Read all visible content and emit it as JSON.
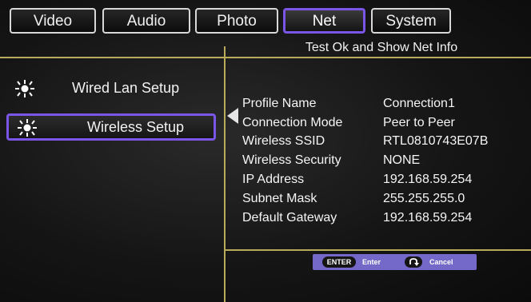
{
  "tabs": [
    {
      "label": "Video"
    },
    {
      "label": "Audio"
    },
    {
      "label": "Photo"
    },
    {
      "label": "Net"
    },
    {
      "label": "System"
    }
  ],
  "active_tab": "Net",
  "subtitle": "Test Ok and Show Net Info",
  "menu": {
    "items": [
      {
        "label": "Wired Lan Setup",
        "icon": "sun-icon"
      },
      {
        "label": "Wireless Setup",
        "icon": "sun-icon",
        "selected": true
      }
    ]
  },
  "net_info": {
    "rows": [
      {
        "key": "Profile Name",
        "value": "Connection1"
      },
      {
        "key": "Connection Mode",
        "value": "Peer to Peer"
      },
      {
        "key": "Wireless SSID",
        "value": "RTL0810743E07B"
      },
      {
        "key": "Wireless Security",
        "value": "NONE"
      },
      {
        "key": "IP Address",
        "value": "192.168.59.254"
      },
      {
        "key": "Subnet Mask",
        "value": "255.255.255.0"
      },
      {
        "key": "Default Gateway",
        "value": "192.168.59.254"
      }
    ]
  },
  "help_bar": {
    "enter_key": "ENTER",
    "enter_label": "Enter",
    "cancel_key_icon": "return-icon",
    "cancel_label": "Cancel"
  },
  "colors": {
    "accent": "#7a56e8",
    "divider": "#b8ab5a",
    "help_bar": "#7468c8"
  }
}
